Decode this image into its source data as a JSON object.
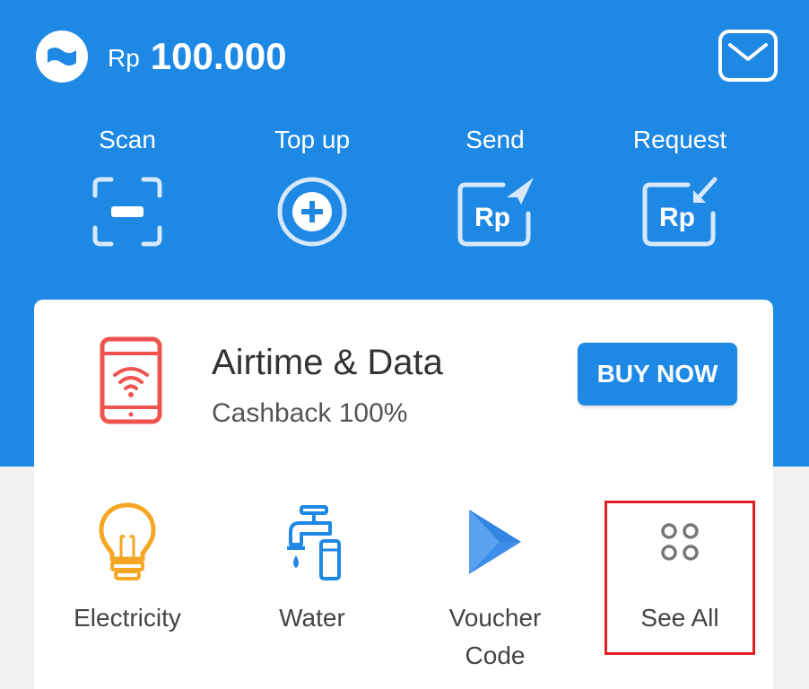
{
  "header": {
    "currency": "Rp",
    "balance": "100.000",
    "logo_icon": "wallet-logo-icon",
    "inbox_icon": "mail-icon"
  },
  "actions": [
    {
      "label": "Scan",
      "icon": "scan-icon"
    },
    {
      "label": "Top up",
      "icon": "plus-circle-icon"
    },
    {
      "label": "Send",
      "icon": "send-rp-icon"
    },
    {
      "label": "Request",
      "icon": "request-rp-icon"
    }
  ],
  "promo": {
    "title": "Airtime & Data",
    "subtitle": "Cashback 100%",
    "button": "BUY NOW",
    "icon": "phone-wifi-icon"
  },
  "services": [
    {
      "label": "Electricity",
      "icon": "lightbulb-icon"
    },
    {
      "label": "Water",
      "icon": "faucet-icon"
    },
    {
      "label": "Voucher Code",
      "icon": "play-store-icon"
    },
    {
      "label": "See All",
      "icon": "grid-dots-icon"
    }
  ],
  "colors": {
    "primary": "#1e88e5",
    "promo_icon": "#ef5350",
    "electricity_icon": "#f5a623",
    "highlight": "#e01e24"
  }
}
